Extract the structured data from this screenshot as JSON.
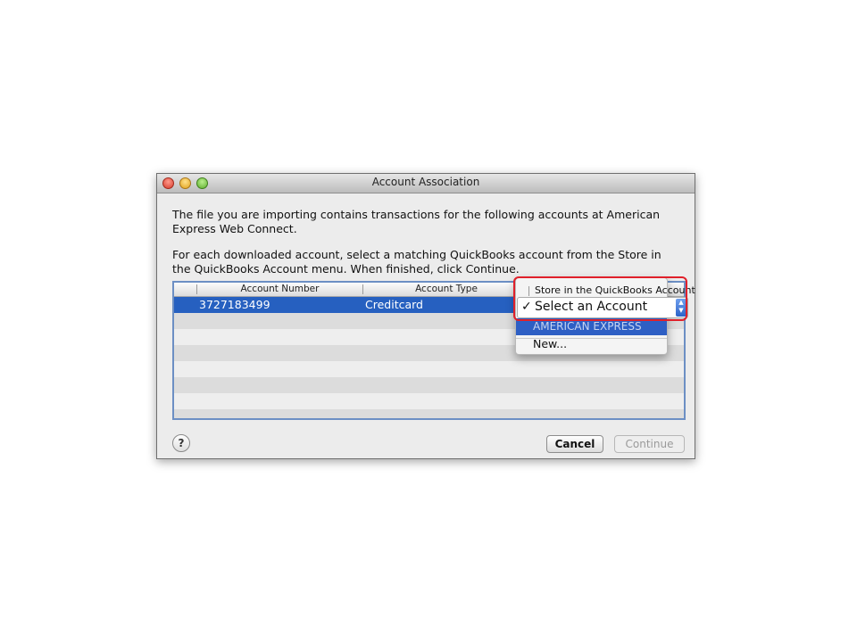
{
  "window": {
    "title": "Account Association",
    "intro_text": "The file you are importing contains transactions for the following accounts at American Express Web Connect.",
    "instructions_text": "For each downloaded account, select a matching QuickBooks account from the Store in the QuickBooks Account menu. When finished, click Continue."
  },
  "table": {
    "columns": [
      "Account Number",
      "Account Type",
      "Store in the QuickBooks Account"
    ],
    "rows": [
      {
        "account_number": "3727183499",
        "account_type": "Creditcard",
        "selected": true
      }
    ]
  },
  "account_menu": {
    "header": "Store in the QuickBooks Account",
    "selected_value": "Select an Account",
    "checkmark": "✓",
    "items": [
      "AMERICAN EXPRESS",
      "New..."
    ]
  },
  "buttons": {
    "help_label": "?",
    "cancel_label": "Cancel",
    "continue_label": "Continue"
  },
  "colors": {
    "selection": "#2660c0",
    "highlight_outline": "#e0202a",
    "table_border": "#6c8fc4"
  }
}
